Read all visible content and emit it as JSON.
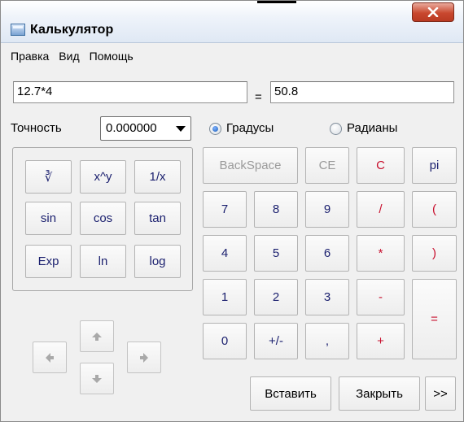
{
  "window": {
    "title": "Калькулятор",
    "close_label": "X"
  },
  "menu": [
    "Правка",
    "Вид",
    "Помощь"
  ],
  "expression": {
    "value": "12.7*4"
  },
  "equals_sign": "=",
  "result": {
    "value": "50.8"
  },
  "precision": {
    "label": "Точность",
    "value": "0.000000"
  },
  "angle_mode": {
    "degrees_label": "Градусы",
    "radians_label": "Радианы",
    "selected": "degrees"
  },
  "functions": {
    "root": "∛",
    "power": "x^y",
    "reciprocal": "1/x",
    "sin": "sin",
    "cos": "cos",
    "tan": "tan",
    "exp": "Exp",
    "ln": "ln",
    "log": "log"
  },
  "edit": {
    "backspace": "BackSpace",
    "ce": "CE",
    "c": "C",
    "pi": "pi"
  },
  "digits": {
    "d7": "7",
    "d8": "8",
    "d9": "9",
    "d4": "4",
    "d5": "5",
    "d6": "6",
    "d1": "1",
    "d2": "2",
    "d3": "3",
    "d0": "0",
    "sign": "+/-",
    "point": ","
  },
  "operators": {
    "divide": "/",
    "open_paren": "(",
    "multiply": "*",
    "close_paren": ")",
    "minus": "-",
    "plus": "+",
    "equals": "="
  },
  "actions": {
    "paste": "Вставить",
    "close": "Закрыть",
    "more": ">>"
  },
  "icons": {
    "arrow_up": "arrow-up-icon",
    "arrow_down": "arrow-down-icon",
    "arrow_left": "arrow-left-icon",
    "arrow_right": "arrow-right-icon"
  },
  "colors": {
    "digit_text": "#1a1f6e",
    "operator_text": "#c8102e",
    "disabled_text": "#9a9a9a"
  }
}
